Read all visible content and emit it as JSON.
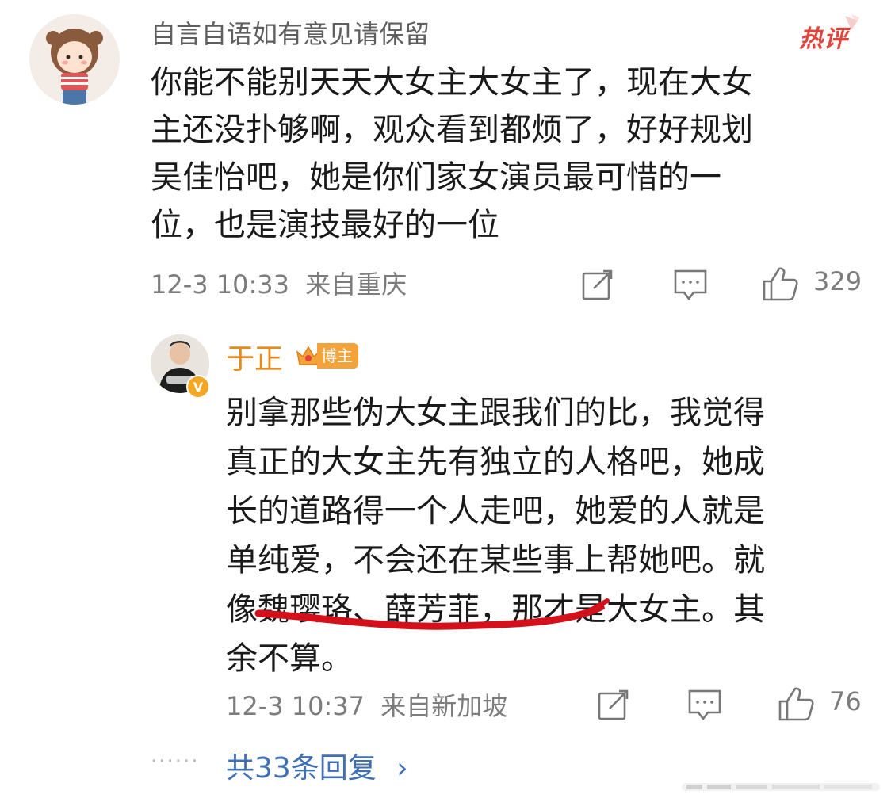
{
  "comment": {
    "username": "自言自语如有意见请保留",
    "badge": "热评",
    "lines": [
      "你能不能别天天大女主大女主了，现在大女",
      "主还没扑够啊，观众看到都烦了，好好规划",
      "吴佳怡吧，她是你们家女演员最可惜的一",
      "位，也是演技最好的一位"
    ],
    "time": "12-3 10:33",
    "location": "来自重庆",
    "likes": "329",
    "icons": [
      "share-icon",
      "comment-icon",
      "like-icon"
    ]
  },
  "reply": {
    "username": "于正",
    "role_badge": "博主",
    "verified_mark": "V",
    "lines": [
      "别拿那些伪大女主跟我们的比，我觉得",
      "真正的大女主先有独立的人格吧，她成",
      "长的道路得一个人走吧，她爱的人就是",
      "单纯爱，不会还在某些事上帮她吧。就",
      "像魏璎珞、薛芳菲，那才是大女主。其",
      "余不算。"
    ],
    "time": "12-3 10:37",
    "location": "来自新加坡",
    "likes": "76",
    "annotation_color": "#d4111b"
  },
  "footer": {
    "dots": "······",
    "more_replies": "共33条回复",
    "more_chevron": "›"
  },
  "colors": {
    "accent_orange": "#e88a1a",
    "link_blue": "#3f6fb5",
    "hot_red": "#e0443b"
  }
}
